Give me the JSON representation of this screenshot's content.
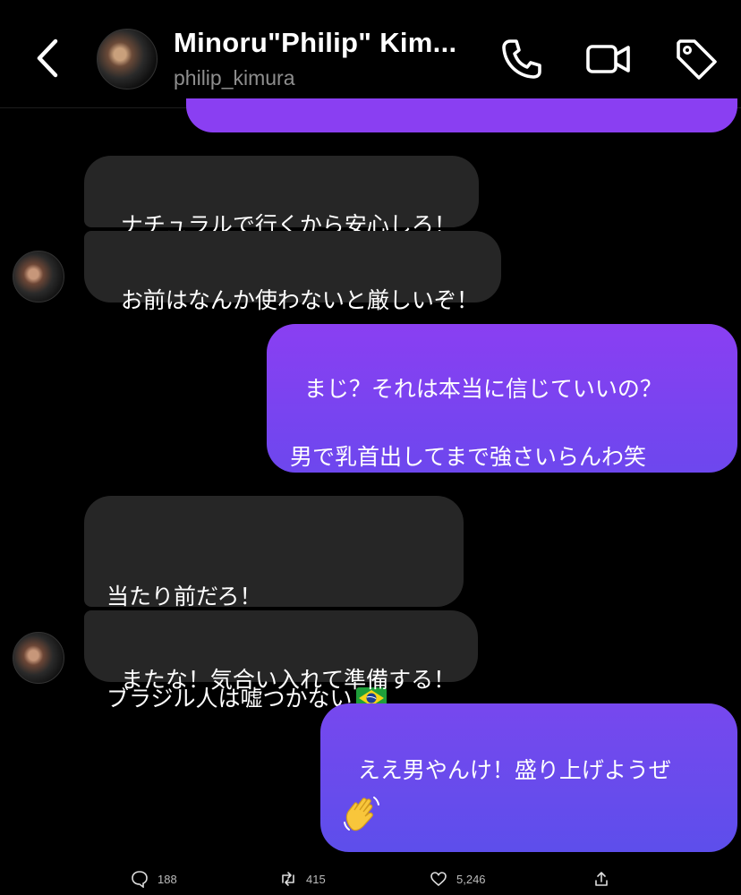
{
  "header": {
    "back_icon": "chevron-left-icon",
    "title": "Minoru\"Philip\" Kim...",
    "username": "philip_kimura",
    "icons": [
      "phone-icon",
      "video-camera-icon",
      "tag-icon"
    ]
  },
  "colors": {
    "background": "#000000",
    "received_bubble": "#262626",
    "sent_gradient_top": "#8a3ff2",
    "sent_gradient_bottom": "#6d47ee",
    "secondary_text": "#8e8e8e"
  },
  "messages": [
    {
      "from": "them",
      "text": "ナチュラルで行くから安心しろ！"
    },
    {
      "from": "them",
      "text": "お前はなんか使わないと厳しいぞ！"
    },
    {
      "from": "me",
      "text": "まじ？それは本当に信じていいの？\n\n男で乳首出してまで強さいらんわ笑"
    },
    {
      "from": "them",
      "line1": "当たり前だろ！",
      "line2": "ブラジル人は嘘つかない",
      "emoji": "brazil-flag-icon"
    },
    {
      "from": "them",
      "text": "またな！気合い入れて準備する！"
    },
    {
      "from": "me",
      "text": "ええ男やんけ！盛り上げようぜ",
      "emoji": "waving-hand-icon"
    }
  ],
  "footer": {
    "replies": "188",
    "reposts": "415",
    "likes": "5,246"
  }
}
